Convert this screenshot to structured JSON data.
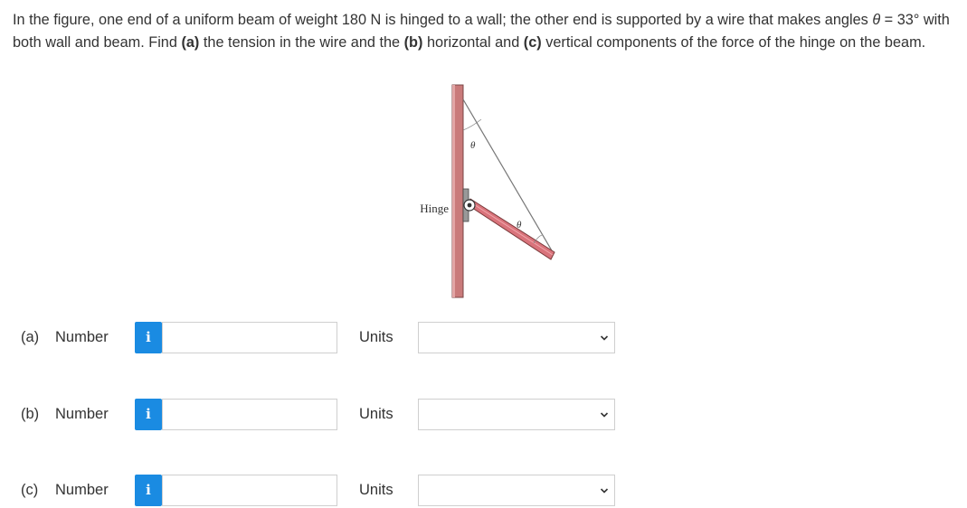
{
  "question": {
    "part1": "In the figure, one end of a uniform beam of weight 180 N is hinged to a wall; the other end is supported by a wire that makes angles ",
    "theta_symbol": "θ",
    "part2": " = 33° with both wall and beam. Find ",
    "a_label": "(a)",
    "part3": " the tension in the wire and the ",
    "b_label": "(b)",
    "part4": " horizontal and ",
    "c_label": "(c)",
    "part5": " vertical components of the force of the hinge on the beam."
  },
  "figure": {
    "hinge_label": "Hinge",
    "theta_top": "θ",
    "theta_beam": "θ",
    "colors": {
      "wall": "#c97a7a",
      "beam": "#d9737b",
      "wire": "#777777"
    }
  },
  "rows": [
    {
      "part": "(a)",
      "number_label": "Number",
      "info_icon": "i",
      "value": "",
      "units_label": "Units",
      "units_value": ""
    },
    {
      "part": "(b)",
      "number_label": "Number",
      "info_icon": "i",
      "value": "",
      "units_label": "Units",
      "units_value": ""
    },
    {
      "part": "(c)",
      "number_label": "Number",
      "info_icon": "i",
      "value": "",
      "units_label": "Units",
      "units_value": ""
    }
  ],
  "colors": {
    "info_button": "#1a8be2",
    "text": "#333333",
    "input_border": "#cfcfcf"
  }
}
